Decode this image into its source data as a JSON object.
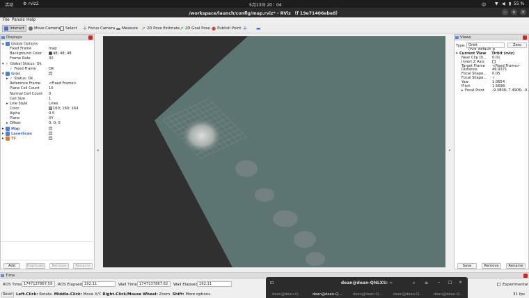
{
  "system_bar": {
    "activities": "活动",
    "app": "rviz2",
    "clock": "5月13日 20：04",
    "input_method": "中",
    "battery": "55 %"
  },
  "window": {
    "title": "/workspace/launch/config/map.rviz* - RViz （f 19e71406ebe8）"
  },
  "menu": {
    "file": "File",
    "panels": "Panels",
    "help": "Help"
  },
  "toolbar": {
    "tools": [
      {
        "label": "Interact",
        "icon": "cursor-icon",
        "color": "#4a6fd1"
      },
      {
        "label": "Move Camera",
        "icon": "move-camera-icon",
        "color": "#6c6c6c"
      },
      {
        "label": "Select",
        "icon": "select-icon",
        "color": "#6c6c6c"
      },
      {
        "label": "Focus Camera",
        "icon": "focus-camera-icon",
        "color": "#7a7a7a"
      },
      {
        "label": "Measure",
        "icon": "measure-icon",
        "color": "#7a7a7a"
      },
      {
        "label": "2D Pose Estimate",
        "icon": "pose-estimate-icon",
        "color": "#3ea43e"
      },
      {
        "label": "2D Goal Pose",
        "icon": "goal-pose-icon",
        "color": "#3ea43e"
      },
      {
        "label": "Publish Point",
        "icon": "publish-point-icon",
        "color": "#d24646"
      }
    ]
  },
  "displays": {
    "title": "Displays",
    "tree": [
      {
        "label": "Global Options",
        "value": "",
        "indent": 1,
        "expander": "▾",
        "icon": "globe"
      },
      {
        "label": "Fixed Frame",
        "value": "map",
        "indent": 2
      },
      {
        "label": "Background Color",
        "value": "48; 48; 48",
        "indent": 2,
        "swatch": "#303030"
      },
      {
        "label": "Frame Rate",
        "value": "30",
        "indent": 2
      },
      {
        "label": "Global Status: Ok",
        "value": "",
        "indent": 1,
        "expander": "▾",
        "check": true
      },
      {
        "label": "Fixed Frame",
        "value": "OK",
        "indent": 2,
        "check": true
      },
      {
        "label": "Grid",
        "value": "",
        "indent": 1,
        "expander": "▾",
        "icon": "grid",
        "blue": true,
        "box": true
      },
      {
        "label": "Status: Ok",
        "value": "",
        "indent": 2,
        "expander": "▸",
        "check": true
      },
      {
        "label": "Reference Frame",
        "value": "<Fixed Frame>",
        "indent": 2
      },
      {
        "label": "Plane Cell Count",
        "value": "10",
        "indent": 2
      },
      {
        "label": "Normal Cell Count",
        "value": "0",
        "indent": 2
      },
      {
        "label": "Cell Size",
        "value": "1",
        "indent": 2
      },
      {
        "label": "Line Style",
        "value": "Lines",
        "indent": 2,
        "expander": "▸"
      },
      {
        "label": "Color",
        "value": "160; 160; 164",
        "indent": 2,
        "swatch": "#a0a0a4"
      },
      {
        "label": "Alpha",
        "value": "0.5",
        "indent": 2
      },
      {
        "label": "Plane",
        "value": "XY",
        "indent": 2
      },
      {
        "label": "Offset",
        "value": "0; 0; 0",
        "indent": 2,
        "expander": "▸"
      },
      {
        "label": "Map",
        "value": "",
        "indent": 1,
        "expander": "▸",
        "icon": "map",
        "blue": true,
        "box": true
      },
      {
        "label": "LaserScan",
        "value": "",
        "indent": 1,
        "expander": "▸",
        "icon": "laser",
        "blue": true,
        "box": true
      },
      {
        "label": "TF",
        "value": "",
        "indent": 1,
        "expander": "▸",
        "icon": "tf",
        "orange": true,
        "box": true
      }
    ],
    "buttons": [
      {
        "label": "Add",
        "enabled": true
      },
      {
        "label": "Duplicate",
        "enabled": false
      },
      {
        "label": "Remove",
        "enabled": false
      },
      {
        "label": "Rename",
        "enabled": false
      }
    ]
  },
  "views": {
    "title": "Views",
    "type_label": "Type:",
    "type_value": "Orbit (rviz_default_p",
    "zero_button": "Zero",
    "rows": [
      {
        "label": "Current View",
        "value": "Orbit (rviz)",
        "bold": true,
        "expander": "▾",
        "indent": 1
      },
      {
        "label": "Near Clip Di...",
        "value": "0.01",
        "indent": 2
      },
      {
        "label": "Invert Z Axis",
        "value": "",
        "indent": 2,
        "box": true
      },
      {
        "label": "Target Frame",
        "value": "<Fixed Frame>",
        "indent": 2
      },
      {
        "label": "Distance",
        "value": "46.9371",
        "indent": 2
      },
      {
        "label": "Focal Shape...",
        "value": "0.05",
        "indent": 2
      },
      {
        "label": "Focal Shape...",
        "value": "✓",
        "indent": 2
      },
      {
        "label": "Yaw",
        "value": "1.0654",
        "indent": 2
      },
      {
        "label": "Pitch",
        "value": "1.5698",
        "indent": 2
      },
      {
        "label": "Focal Point",
        "value": "-9.3806; 7.4906; -0...",
        "indent": 2,
        "expander": "▸"
      }
    ],
    "buttons": [
      "Save",
      "Remove",
      "Rename"
    ]
  },
  "time_panel": {
    "title": "Time",
    "ros_time_label": "ROS Time:",
    "ros_time": "1747137867.59",
    "ros_elapsed_label": "ROS Elapsed:",
    "ros_elapsed": "192.11",
    "wall_time_label": "Wall Time:",
    "wall_time": "1747137867.62",
    "wall_elapsed_label": "Wall Elapsed:",
    "wall_elapsed": "192.11",
    "experimental": "Experimental"
  },
  "status": {
    "reset": "Reset",
    "left": "Left-Click:",
    "left_desc": " Rotate. ",
    "middle": "Middle-Click:",
    "middle_desc": " Move X/Y. ",
    "right": "Right-Click/Mouse Wheel:",
    "right_desc": " Zoom. ",
    "shift": "Shift:",
    "shift_desc": " More options.",
    "fps": "31 fps"
  },
  "terminal": {
    "title": "dean@dean-QNLXS: ~",
    "tabs": [
      "dean@dean-Q...",
      "dean@dean-Q...",
      "dean@dean-Q...",
      "dean@dean-Q...",
      "dean@dean-Q..."
    ]
  },
  "colors": {
    "viewport_bg": "#303030",
    "map_free": "#5d7572",
    "grid_lines": "#a0a0a4"
  }
}
